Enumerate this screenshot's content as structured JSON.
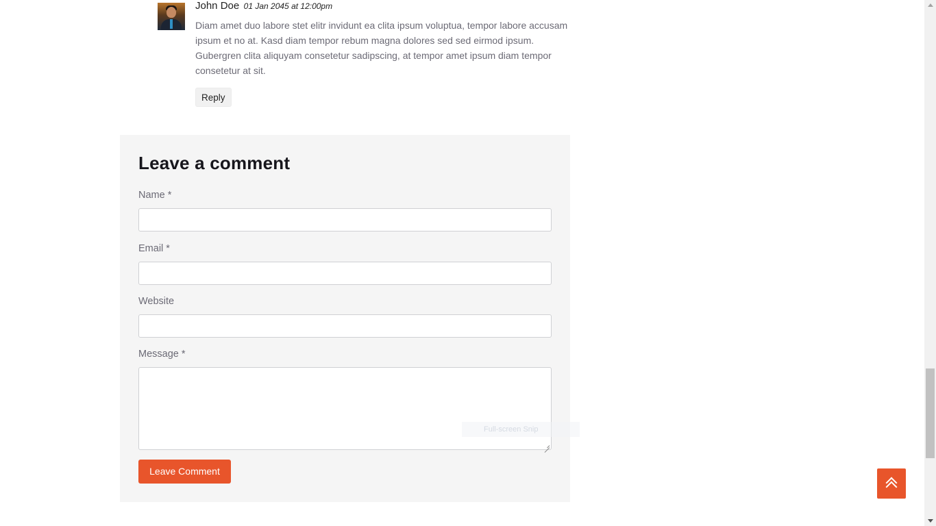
{
  "comment": {
    "author": "John Doe",
    "date": "01 Jan 2045 at 12:00pm",
    "text": "Diam amet duo labore stet elitr invidunt ea clita ipsum voluptua, tempor labore accusam ipsum et no at. Kasd diam tempor rebum magna dolores sed sed eirmod ipsum. Gubergren clita aliquyam consetetur sadipscing, at tempor amet ipsum diam tempor consetetur at sit.",
    "reply_label": "Reply"
  },
  "form": {
    "title": "Leave a comment",
    "name_label": "Name *",
    "email_label": "Email *",
    "website_label": "Website",
    "message_label": "Message *",
    "name_value": "",
    "email_value": "",
    "website_value": "",
    "message_value": "",
    "submit_label": "Leave Comment"
  },
  "overlay": {
    "snip_text": "Full-screen Snip"
  },
  "back_to_top": {
    "icon": "double-chevron-up-icon"
  },
  "colors": {
    "accent": "#e8552b",
    "panel_bg": "#f5f5f5",
    "text_muted": "#6b6a75",
    "heading": "#17161c"
  },
  "scroll": {
    "position_fraction": 0.89
  }
}
